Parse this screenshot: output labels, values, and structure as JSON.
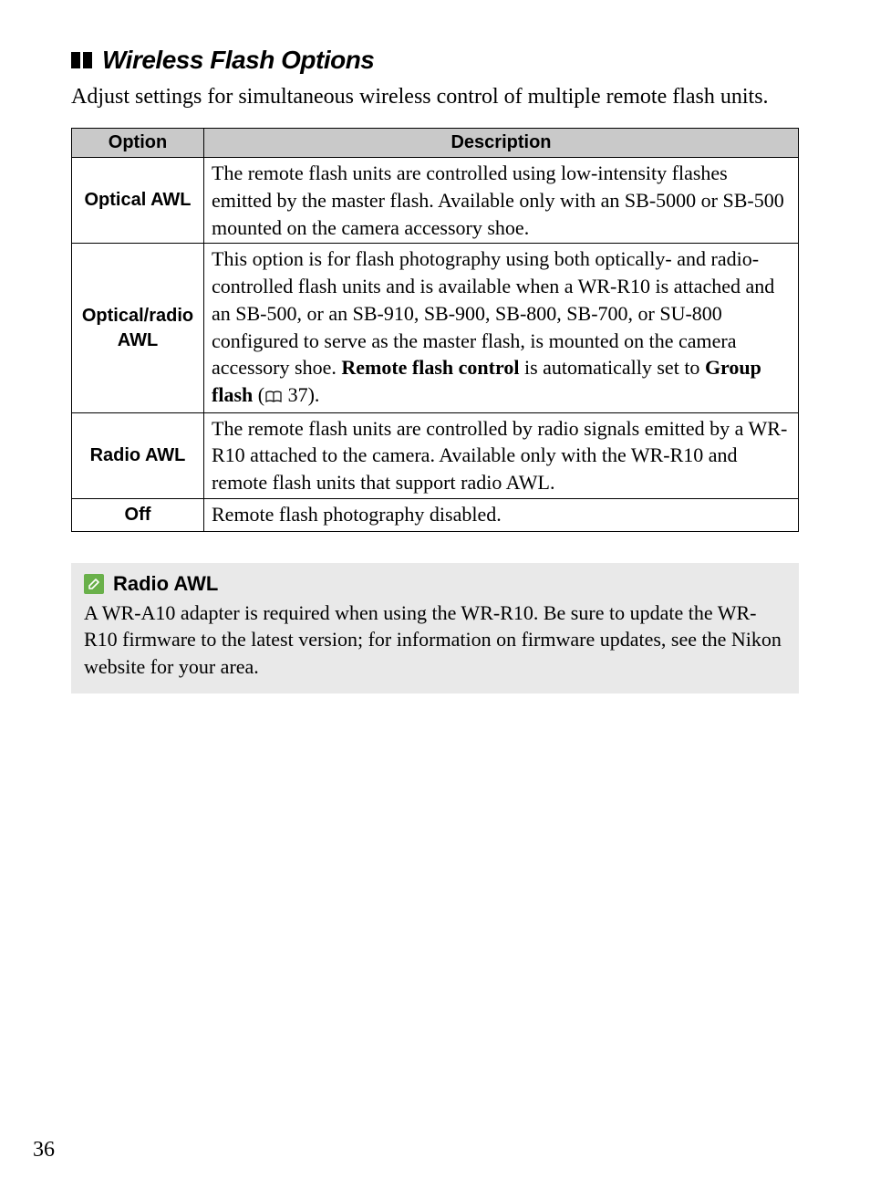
{
  "heading": "Wireless Flash Options",
  "intro": "Adjust settings for simultaneous wireless control of multiple remote flash units.",
  "table": {
    "headers": {
      "option": "Option",
      "description": "Description"
    },
    "rows": [
      {
        "option": "Optical AWL",
        "desc": "The remote flash units are controlled using low-intensity flashes emitted by the master flash.  Available only with an SB-5000 or SB-500 mounted on the camera accessory shoe."
      },
      {
        "option": "Optical/radio\nAWL",
        "desc_pre": "This option is for flash photography using both optically- and radio-controlled flash units and is available when a WR-R10 is attached and an SB-500, or an SB-910, SB-900, SB-800, SB-700, or SU-800 configured to serve as the master flash, is mounted on the camera accessory shoe.  ",
        "desc_bold1": "Remote flash control",
        "desc_mid": " is automatically set to ",
        "desc_bold2": "Group flash",
        "desc_post_open": " (",
        "desc_ref": "37",
        "desc_post_close": ")."
      },
      {
        "option": "Radio AWL",
        "desc": "The remote flash units are controlled by radio signals emitted by a WR-R10 attached to the camera.  Available only with the WR-R10 and remote flash units that support radio AWL."
      },
      {
        "option": "Off",
        "desc": "Remote flash photography disabled."
      }
    ]
  },
  "note": {
    "title": "Radio AWL",
    "body": "A WR-A10 adapter is required when using the WR-R10.  Be sure to update the WR-R10 firmware to the latest version; for information on firmware updates, see the Nikon website for your area."
  },
  "page_number": "36"
}
